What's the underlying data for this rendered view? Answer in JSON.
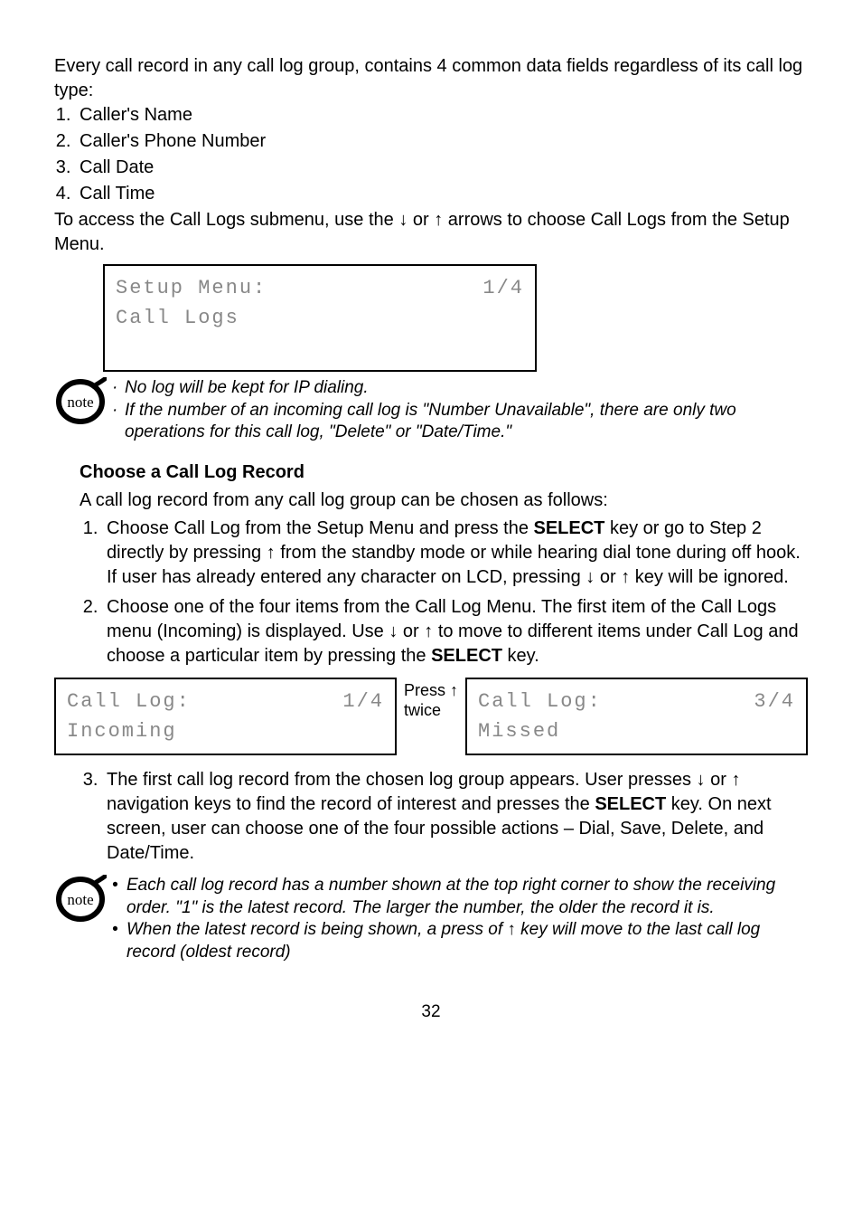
{
  "intro_p1": "Every call record in any call log group, contains 4 common data fields regardless of its call log type:",
  "intro_list": {
    "i1": "Caller's Name",
    "i2": "Caller's Phone Number",
    "i3": "Call Date",
    "i4": "Call Time"
  },
  "intro_p2a": "To access the Call Logs submenu, use the ",
  "intro_p2b": " or ",
  "intro_p2c": " arrows to choose Call Logs from the Setup Menu.",
  "lcd1": {
    "title": "Setup Menu:",
    "page": "1/4",
    "line": "Call Logs"
  },
  "note1": {
    "l1": "No log will be kept for IP dialing.",
    "l2": "If the number of an incoming call log is \"Number Unavailable\", there are only two operations for this call log, \"Delete\" or \"Date/Time.\""
  },
  "choose_heading": "Choose a Call Log Record",
  "choose_intro": "A call log record from any call log group can be chosen as follows:",
  "steps": {
    "s1a": "Choose Call Log from the Setup Menu and press the ",
    "s1b": " key or go to Step 2 directly by pressing ",
    "s1c": " from the standby mode or while hearing dial tone during off hook. If user has already entered any character on LCD, pressing ",
    "s1d": " or ",
    "s1e": " key will be ignored.",
    "s2a": "Choose one of the four items from the Call Log Menu. The first item of the Call Logs menu (Incoming) is displayed. Use ",
    "s2b": " or ",
    "s2c": " to move to different items under Call Log and choose a particular item by pressing the ",
    "s2d": " key.",
    "s3a": "The first call log record from the chosen log group appears. User presses ",
    "s3b": " or ",
    "s3c": " navigation keys to find the record of interest and presses the ",
    "s3d": " key. On next screen, user can choose one of the four possible actions – Dial, Save, Delete, and Date/Time."
  },
  "select_label": "SELECT",
  "arrows": {
    "up": "↑",
    "down": "↓"
  },
  "mid": {
    "l1": "Press ↑",
    "l2": "twice"
  },
  "lcd2": {
    "title": "Call Log:",
    "page": "1/4",
    "line": "Incoming"
  },
  "lcd3": {
    "title": "Call Log:",
    "page": "3/4",
    "line": "Missed"
  },
  "note2": {
    "l1": "Each call log record has a number shown at the top right corner to show the receiving order. \"1\" is the latest record. The larger the number, the older the record it is.",
    "l2a": "When the latest record is being shown, a press of ",
    "l2b": " key will move to the last call log record (oldest record)"
  },
  "page_number": "32"
}
